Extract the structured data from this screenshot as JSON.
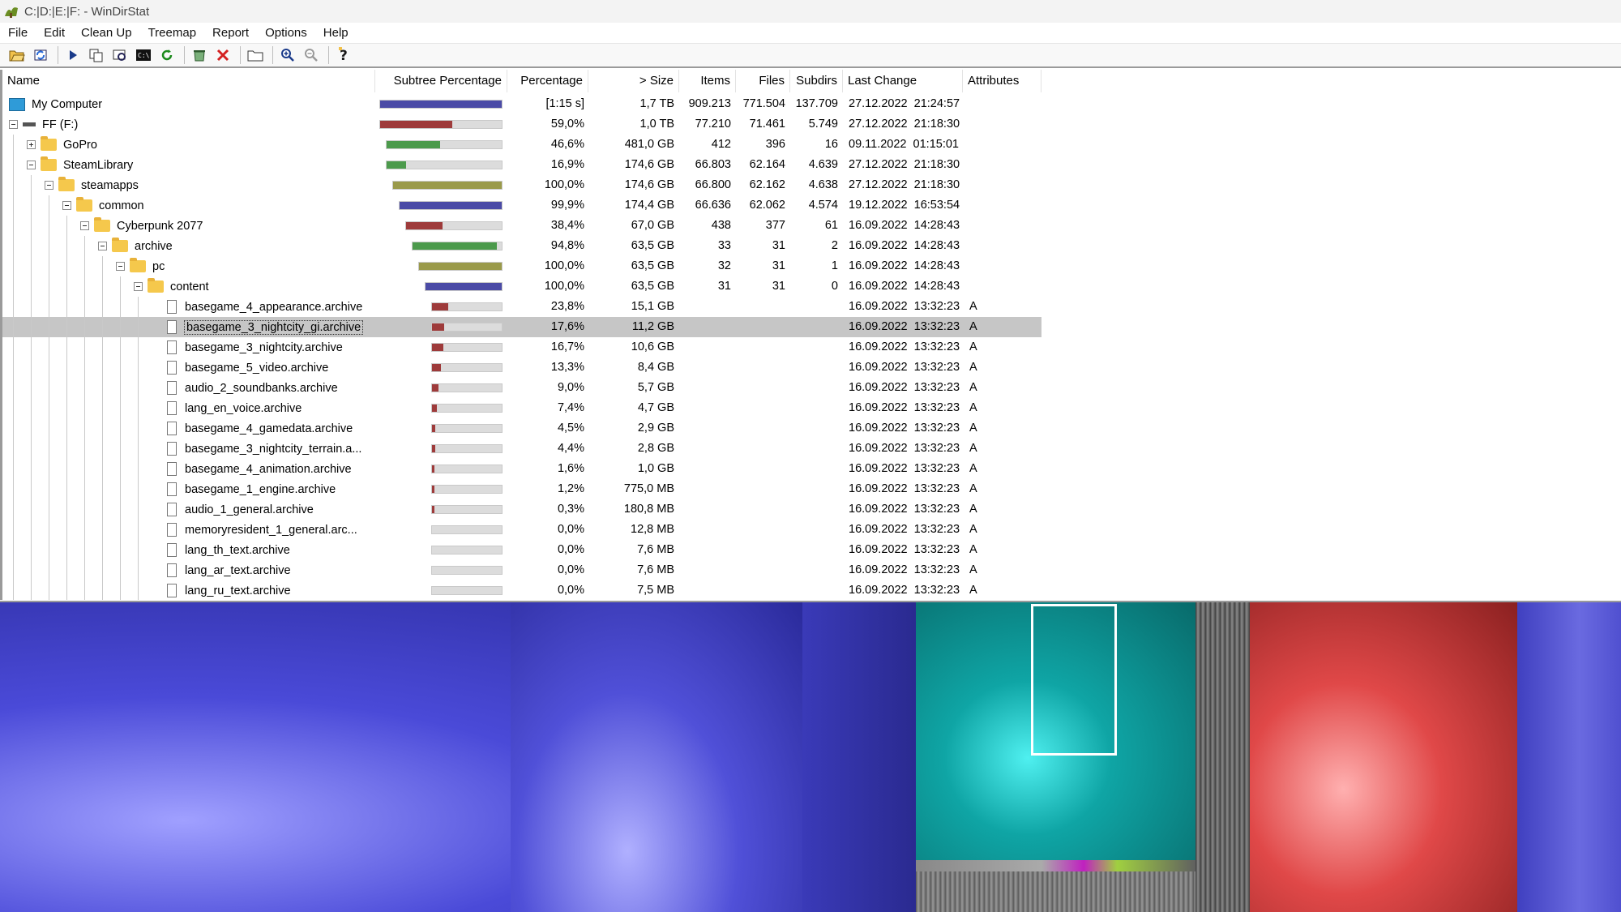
{
  "window": {
    "title": "C:|D:|E:|F: - WinDirStat"
  },
  "menu": [
    "File",
    "Edit",
    "Clean Up",
    "Treemap",
    "Report",
    "Options",
    "Help"
  ],
  "toolbar_icons": [
    "open-icon",
    "refresh-all-icon",
    "play-icon",
    "copy-path-icon",
    "explorer-icon",
    "command-prompt-icon",
    "refresh-icon",
    "recycle-icon",
    "delete-icon",
    "new-folder-icon",
    "zoom-in-icon",
    "zoom-out-icon",
    "help-icon"
  ],
  "columns": {
    "name": "Name",
    "subtree": "Subtree Percentage",
    "percentage": "Percentage",
    "size": "> Size",
    "items": "Items",
    "files": "Files",
    "subdirs": "Subdirs",
    "last_change": "Last Change",
    "attributes": "Attributes"
  },
  "rows": [
    {
      "name": "My Computer",
      "type": "computer",
      "level": 0,
      "expander": "none",
      "pct": "[1:15 s]",
      "sub": 1.0,
      "color": "#4b4ba6",
      "size": "1,7 TB",
      "items": "909.213",
      "files": "771.504",
      "subdirs": "137.709",
      "date": "27.12.2022  21:24:57",
      "attr": ""
    },
    {
      "name": "FF (F:)",
      "type": "drive",
      "level": 0,
      "expander": "minus",
      "pct": "59,0%",
      "sub": 0.59,
      "color": "#9e3b3b",
      "size": "1,0 TB",
      "items": "77.210",
      "files": "71.461",
      "subdirs": "5.749",
      "date": "27.12.2022  21:18:30",
      "attr": ""
    },
    {
      "name": "GoPro",
      "type": "folder",
      "level": 1,
      "expander": "plus",
      "pct": "46,6%",
      "sub": 0.466,
      "color": "#4c9a4c",
      "size": "481,0 GB",
      "items": "412",
      "files": "396",
      "subdirs": "16",
      "date": "09.11.2022  01:15:01",
      "attr": ""
    },
    {
      "name": "SteamLibrary",
      "type": "folder",
      "level": 1,
      "expander": "minus",
      "pct": "16,9%",
      "sub": 0.169,
      "color": "#4c9a4c",
      "size": "174,6 GB",
      "items": "66.803",
      "files": "62.164",
      "subdirs": "4.639",
      "date": "27.12.2022  21:18:30",
      "attr": ""
    },
    {
      "name": "steamapps",
      "type": "folder",
      "level": 2,
      "expander": "minus",
      "pct": "100,0%",
      "sub": 1.0,
      "color": "#9a9a4a",
      "size": "174,6 GB",
      "items": "66.800",
      "files": "62.162",
      "subdirs": "4.638",
      "date": "27.12.2022  21:18:30",
      "attr": ""
    },
    {
      "name": "common",
      "type": "folder",
      "level": 3,
      "expander": "minus",
      "pct": "99,9%",
      "sub": 0.999,
      "color": "#4b4ba6",
      "size": "174,4 GB",
      "items": "66.636",
      "files": "62.062",
      "subdirs": "4.574",
      "date": "19.12.2022  16:53:54",
      "attr": ""
    },
    {
      "name": "Cyberpunk 2077",
      "type": "folder",
      "level": 4,
      "expander": "minus",
      "pct": "38,4%",
      "sub": 0.384,
      "color": "#9e3b3b",
      "size": "67,0 GB",
      "items": "438",
      "files": "377",
      "subdirs": "61",
      "date": "16.09.2022  14:28:43",
      "attr": ""
    },
    {
      "name": "archive",
      "type": "folder",
      "level": 5,
      "expander": "minus",
      "pct": "94,8%",
      "sub": 0.948,
      "color": "#4c9a4c",
      "size": "63,5 GB",
      "items": "33",
      "files": "31",
      "subdirs": "2",
      "date": "16.09.2022  14:28:43",
      "attr": ""
    },
    {
      "name": "pc",
      "type": "folder",
      "level": 6,
      "expander": "minus",
      "pct": "100,0%",
      "sub": 1.0,
      "color": "#9a9a4a",
      "size": "63,5 GB",
      "items": "32",
      "files": "31",
      "subdirs": "1",
      "date": "16.09.2022  14:28:43",
      "attr": ""
    },
    {
      "name": "content",
      "type": "folder",
      "level": 7,
      "expander": "minus",
      "pct": "100,0%",
      "sub": 1.0,
      "color": "#4b4ba6",
      "size": "63,5 GB",
      "items": "31",
      "files": "31",
      "subdirs": "0",
      "date": "16.09.2022  14:28:43",
      "attr": ""
    },
    {
      "name": "basegame_4_appearance.archive",
      "type": "file",
      "level": 8,
      "expander": "none",
      "pct": "23,8%",
      "sub": 0.238,
      "color": "#9e3b3b",
      "size": "15,1 GB",
      "items": "",
      "files": "",
      "subdirs": "",
      "date": "16.09.2022  13:32:23",
      "attr": "A"
    },
    {
      "name": "basegame_3_nightcity_gi.archive",
      "type": "file",
      "level": 8,
      "expander": "none",
      "pct": "17,6%",
      "sub": 0.176,
      "color": "#9e3b3b",
      "size": "11,2 GB",
      "items": "",
      "files": "",
      "subdirs": "",
      "date": "16.09.2022  13:32:23",
      "attr": "A",
      "selected": true
    },
    {
      "name": "basegame_3_nightcity.archive",
      "type": "file",
      "level": 8,
      "expander": "none",
      "pct": "16,7%",
      "sub": 0.167,
      "color": "#9e3b3b",
      "size": "10,6 GB",
      "items": "",
      "files": "",
      "subdirs": "",
      "date": "16.09.2022  13:32:23",
      "attr": "A"
    },
    {
      "name": "basegame_5_video.archive",
      "type": "file",
      "level": 8,
      "expander": "none",
      "pct": "13,3%",
      "sub": 0.133,
      "color": "#9e3b3b",
      "size": "8,4 GB",
      "items": "",
      "files": "",
      "subdirs": "",
      "date": "16.09.2022  13:32:23",
      "attr": "A"
    },
    {
      "name": "audio_2_soundbanks.archive",
      "type": "file",
      "level": 8,
      "expander": "none",
      "pct": "9,0%",
      "sub": 0.09,
      "color": "#9e3b3b",
      "size": "5,7 GB",
      "items": "",
      "files": "",
      "subdirs": "",
      "date": "16.09.2022  13:32:23",
      "attr": "A"
    },
    {
      "name": "lang_en_voice.archive",
      "type": "file",
      "level": 8,
      "expander": "none",
      "pct": "7,4%",
      "sub": 0.074,
      "color": "#9e3b3b",
      "size": "4,7 GB",
      "items": "",
      "files": "",
      "subdirs": "",
      "date": "16.09.2022  13:32:23",
      "attr": "A"
    },
    {
      "name": "basegame_4_gamedata.archive",
      "type": "file",
      "level": 8,
      "expander": "none",
      "pct": "4,5%",
      "sub": 0.045,
      "color": "#9e3b3b",
      "size": "2,9 GB",
      "items": "",
      "files": "",
      "subdirs": "",
      "date": "16.09.2022  13:32:23",
      "attr": "A"
    },
    {
      "name": "basegame_3_nightcity_terrain.a...",
      "type": "file",
      "level": 8,
      "expander": "none",
      "pct": "4,4%",
      "sub": 0.044,
      "color": "#9e3b3b",
      "size": "2,8 GB",
      "items": "",
      "files": "",
      "subdirs": "",
      "date": "16.09.2022  13:32:23",
      "attr": "A"
    },
    {
      "name": "basegame_4_animation.archive",
      "type": "file",
      "level": 8,
      "expander": "none",
      "pct": "1,6%",
      "sub": 0.016,
      "color": "#9e3b3b",
      "size": "1,0 GB",
      "items": "",
      "files": "",
      "subdirs": "",
      "date": "16.09.2022  13:32:23",
      "attr": "A"
    },
    {
      "name": "basegame_1_engine.archive",
      "type": "file",
      "level": 8,
      "expander": "none",
      "pct": "1,2%",
      "sub": 0.012,
      "color": "#9e3b3b",
      "size": "775,0 MB",
      "items": "",
      "files": "",
      "subdirs": "",
      "date": "16.09.2022  13:32:23",
      "attr": "A"
    },
    {
      "name": "audio_1_general.archive",
      "type": "file",
      "level": 8,
      "expander": "none",
      "pct": "0,3%",
      "sub": 0.003,
      "color": "#9e3b3b",
      "size": "180,8 MB",
      "items": "",
      "files": "",
      "subdirs": "",
      "date": "16.09.2022  13:32:23",
      "attr": "A"
    },
    {
      "name": "memoryresident_1_general.arc...",
      "type": "file",
      "level": 8,
      "expander": "none",
      "pct": "0,0%",
      "sub": 0.0,
      "color": "#9e3b3b",
      "size": "12,8 MB",
      "items": "",
      "files": "",
      "subdirs": "",
      "date": "16.09.2022  13:32:23",
      "attr": "A"
    },
    {
      "name": "lang_th_text.archive",
      "type": "file",
      "level": 8,
      "expander": "none",
      "pct": "0,0%",
      "sub": 0.0,
      "color": "#9e3b3b",
      "size": "7,6 MB",
      "items": "",
      "files": "",
      "subdirs": "",
      "date": "16.09.2022  13:32:23",
      "attr": "A"
    },
    {
      "name": "lang_ar_text.archive",
      "type": "file",
      "level": 8,
      "expander": "none",
      "pct": "0,0%",
      "sub": 0.0,
      "color": "#9e3b3b",
      "size": "7,6 MB",
      "items": "",
      "files": "",
      "subdirs": "",
      "date": "16.09.2022  13:32:23",
      "attr": "A"
    },
    {
      "name": "lang_ru_text.archive",
      "type": "file",
      "level": 8,
      "expander": "none",
      "pct": "0,0%",
      "sub": 0.0,
      "color": "#9e3b3b",
      "size": "7,5 MB",
      "items": "",
      "files": "",
      "subdirs": "",
      "date": "16.09.2022  13:32:23",
      "attr": "A"
    }
  ],
  "treemap_colors": {
    "blue": "#4a4ad8",
    "teal": "#0fa5a5",
    "gray": "#7a7a7a",
    "red": "#d84a4a",
    "blue_right": "#5a5ad8"
  }
}
